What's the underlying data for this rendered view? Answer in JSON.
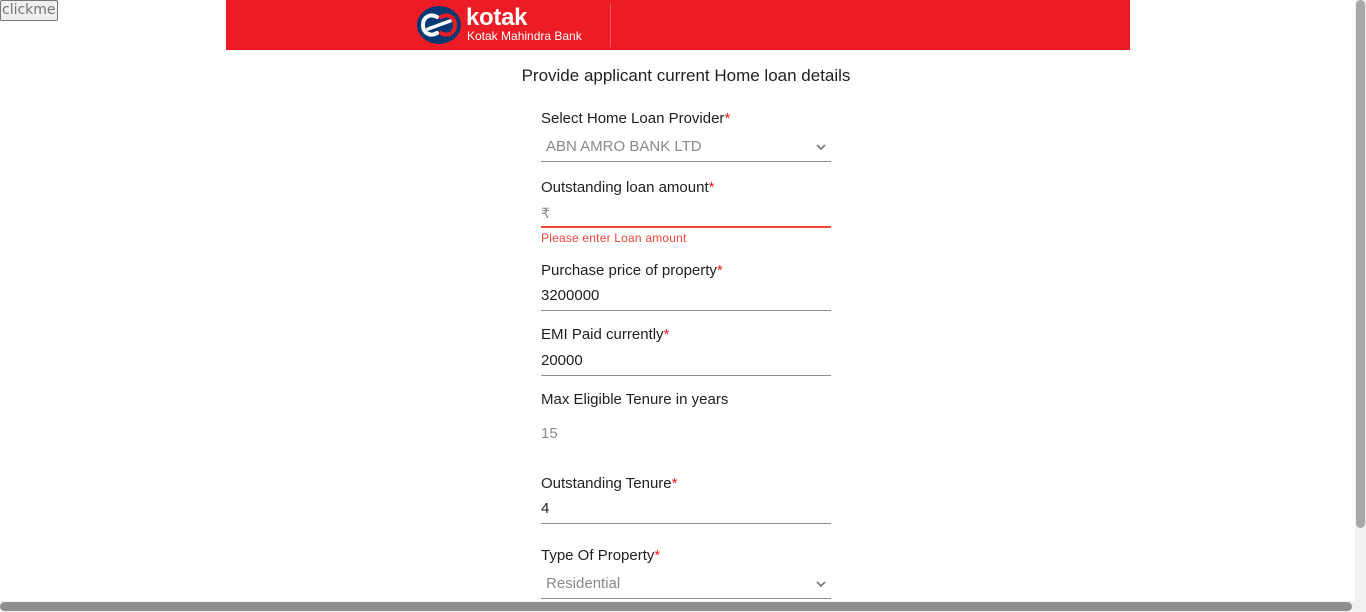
{
  "debug_button": {
    "label": "clickme"
  },
  "header": {
    "brand_name": "kotak",
    "brand_subtitle": "Kotak Mahindra Bank",
    "brand_color": "#ed1c24",
    "logo_icon": "kotak-infinity-logo"
  },
  "form": {
    "title": "Provide applicant current Home loan details",
    "required_marker": "*",
    "fields": {
      "loan_provider": {
        "label": "Select Home Loan Provider",
        "value": "ABN AMRO BANK LTD",
        "icon": "chevron-down-icon"
      },
      "outstanding_amount": {
        "label": "Outstanding loan amount",
        "prefix": "₹",
        "value": "",
        "error": "Please enter Loan amount"
      },
      "purchase_price": {
        "label": "Purchase price of property",
        "value": "3200000"
      },
      "emi_paid": {
        "label": "EMI Paid currently",
        "value": "20000"
      },
      "max_tenure": {
        "label": "Max Eligible Tenure in years",
        "value": "15"
      },
      "outstanding_tenure": {
        "label": "Outstanding Tenure",
        "value": "4"
      },
      "property_type": {
        "label": "Type Of Property",
        "value": "Residential",
        "icon": "chevron-down-icon"
      }
    }
  },
  "colors": {
    "error": "#f04438",
    "required": "#ed1c24",
    "placeholder": "#8a8a8a"
  }
}
